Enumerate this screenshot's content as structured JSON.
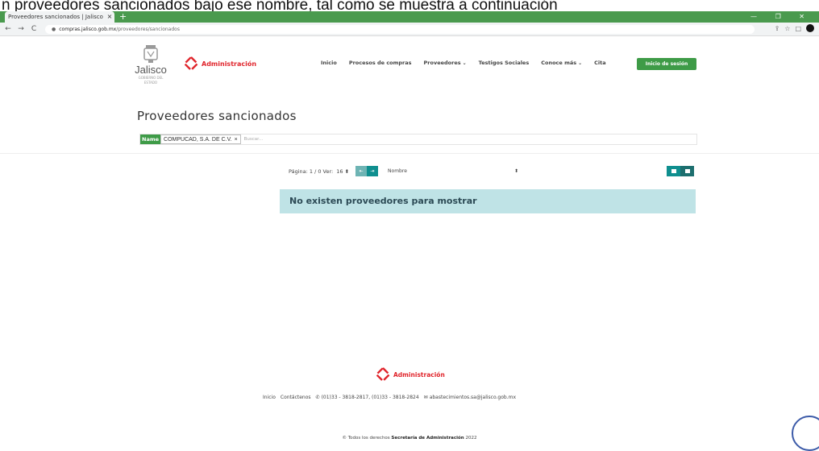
{
  "caption": "n proveedores sancionados bajo ese nombre, tal como se muestra a continuación",
  "browser": {
    "tab_title": "Proveedores sancionados | Jalisco",
    "tab_close": "×",
    "new_tab": "+",
    "window_controls": "— ❐ ✕",
    "back": "←",
    "forward": "→",
    "reload": "C",
    "url_host": "compras.jalisco.gob.mx",
    "url_path": "/proveedores/sancionados"
  },
  "header": {
    "logo_text": "Jalisco",
    "logo_sub": "GOBIERNO DEL ESTADO",
    "admin_text": "Administración",
    "nav": [
      {
        "label": "Inicio"
      },
      {
        "label": "Procesos de compras"
      },
      {
        "label": "Proveedores",
        "caret": "⌄"
      },
      {
        "label": "Testigos Sociales"
      },
      {
        "label": "Conoce más",
        "caret": "⌄"
      },
      {
        "label": "Cita"
      }
    ],
    "login_label": "Inicio de sesión"
  },
  "main": {
    "title": "Proveedores sancionados",
    "filter": {
      "key": "Name",
      "value": "COMPUCAD, S.A. DE C.V.",
      "remove": "×",
      "search_placeholder": "Buscar..."
    },
    "pager": {
      "page_text": "Página: 1 / 0 Ver:",
      "per_page": "16 ⬍",
      "first_icon": "⇤",
      "prev_icon": "⇥",
      "sort_value": "Nombre",
      "sort_caret": "⬍"
    },
    "empty_message": "No existen proveedores para mostrar"
  },
  "footer": {
    "admin_text": "Administración",
    "links": [
      {
        "label": "Inicio"
      },
      {
        "label": "Contáctenos"
      },
      {
        "icon": "✆",
        "label": "(01)33 - 3818-2817, (01)33 - 3818-2824"
      },
      {
        "icon": "✉",
        "label": "abastecimientos.sa@jalisco.gob.mx"
      }
    ],
    "copyright_prefix": "© Todos los derechos",
    "copyright_org": "Secretaría de Administración",
    "copyright_year": "2022"
  },
  "colors": {
    "brand_green": "#3e9b47",
    "admin_red": "#e0252c",
    "teal": "#0f8f8f",
    "alert_bg": "#bfe3e6"
  }
}
